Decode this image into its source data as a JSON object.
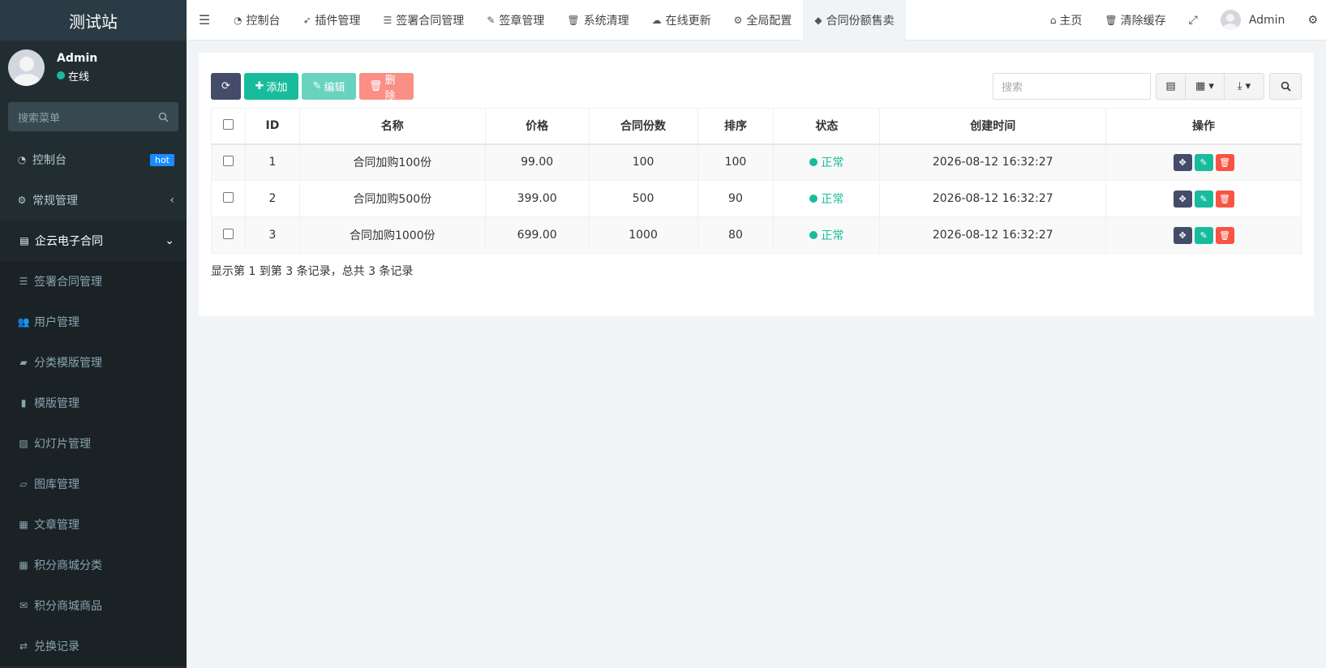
{
  "brand": "测试站",
  "user": {
    "name": "Admin",
    "status": "在线"
  },
  "sidebar": {
    "search_placeholder": "搜索菜单",
    "items": [
      {
        "label": "控制台",
        "badge": "hot"
      },
      {
        "label": "常规管理"
      },
      {
        "label": "企云电子合同"
      }
    ],
    "subitems": [
      {
        "label": "签署合同管理"
      },
      {
        "label": "用户管理"
      },
      {
        "label": "分类模版管理"
      },
      {
        "label": "模版管理"
      },
      {
        "label": "幻灯片管理"
      },
      {
        "label": "图库管理"
      },
      {
        "label": "文章管理"
      },
      {
        "label": "积分商城分类"
      },
      {
        "label": "积分商城商品"
      },
      {
        "label": "兑换记录"
      }
    ]
  },
  "topnav": {
    "tabs": [
      {
        "label": "控制台"
      },
      {
        "label": "插件管理"
      },
      {
        "label": "签署合同管理"
      },
      {
        "label": "签章管理"
      },
      {
        "label": "系统清理"
      },
      {
        "label": "在线更新"
      },
      {
        "label": "全局配置"
      },
      {
        "label": "合同份额售卖"
      }
    ],
    "home": "主页",
    "clear_cache": "清除缓存",
    "admin": "Admin"
  },
  "toolbar": {
    "add": "添加",
    "edit": "编辑",
    "delete": "删除",
    "search_placeholder": "搜索"
  },
  "table": {
    "headers": [
      "ID",
      "名称",
      "价格",
      "合同份数",
      "排序",
      "状态",
      "创建时间",
      "操作"
    ],
    "rows": [
      {
        "id": "1",
        "name": "合同加购100份",
        "price": "99.00",
        "count": "100",
        "sort": "100",
        "status": "正常",
        "created": "2026-08-12 16:32:27"
      },
      {
        "id": "2",
        "name": "合同加购500份",
        "price": "399.00",
        "count": "500",
        "sort": "90",
        "status": "正常",
        "created": "2026-08-12 16:32:27"
      },
      {
        "id": "3",
        "name": "合同加购1000份",
        "price": "699.00",
        "count": "1000",
        "sort": "80",
        "status": "正常",
        "created": "2026-08-12 16:32:27"
      }
    ]
  },
  "pagination": {
    "summary": "显示第 1 到第 3 条记录，总共 3 条记录"
  },
  "colors": {
    "sidebar_bg": "#222d32",
    "accent": "#18bc9c",
    "danger": "#f75444",
    "primary_dark": "#444c69"
  }
}
